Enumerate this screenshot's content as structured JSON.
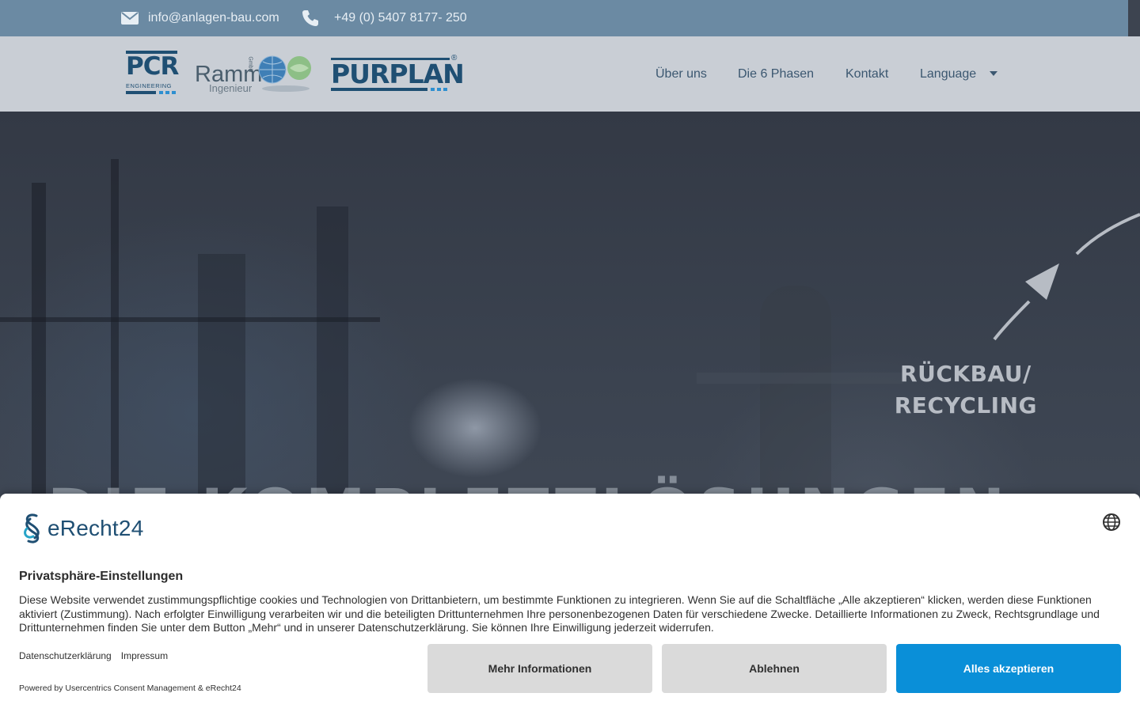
{
  "topbar": {
    "email": "info@anlagen-bau.com",
    "phone": "+49 (0) 5407 8177- 250",
    "email_icon": "envelope-icon",
    "phone_icon": "phone-icon"
  },
  "logos": {
    "pcr": {
      "main": "PCR",
      "sub": "ENGINEERING"
    },
    "ramm": {
      "main": "Ramm",
      "sub": "Ingenieur",
      "tag": "GmbH"
    },
    "purplan": {
      "main": "PURPLAN",
      "mark": "®"
    }
  },
  "nav": {
    "items": [
      "Über uns",
      "Die 6 Phasen",
      "Kontakt"
    ],
    "language": "Language"
  },
  "hero": {
    "hint_line1": "RÜCKBAU/",
    "hint_line2": "RECYCLING",
    "headline": "DIE KOMPLETTLÖSUNGEN"
  },
  "consent": {
    "brand": "eRecht24",
    "title": "Privatsphäre-Einstellungen",
    "description": "Diese Website verwendet zustimmungspflichtige cookies und Technologien von Drittanbietern, um bestimmte Funktionen zu integrieren. Wenn Sie auf die Schaltfläche „Alle akzeptieren“ klicken, werden diese Funktionen aktiviert (Zustimmung). Nach erfolgter Einwilligung verarbeiten wir und die beteiligten Drittunternehmen Ihre personenbezogenen Daten für verschiedene Zwecke. Detaillierte Informationen zu Zweck, Rechtsgrundlage und Drittunternehmen finden Sie unter dem Button „Mehr“ und in unserer Datenschutzerklärung. Sie können Ihre Einwilligung jederzeit widerrufen.",
    "link_privacy": "Datenschutzerklärung",
    "link_imprint": "Impressum",
    "powered": "Powered by Usercentrics Consent Management & eRecht24",
    "btn_more": "Mehr Informationen",
    "btn_decline": "Ablehnen",
    "btn_accept": "Alles akzeptieren"
  },
  "colors": {
    "topbar": "#6b8aa3",
    "header": "#c9ced5",
    "nav_text": "#3b5770",
    "accept": "#0a8fd8",
    "grey_button": "#dadada"
  }
}
